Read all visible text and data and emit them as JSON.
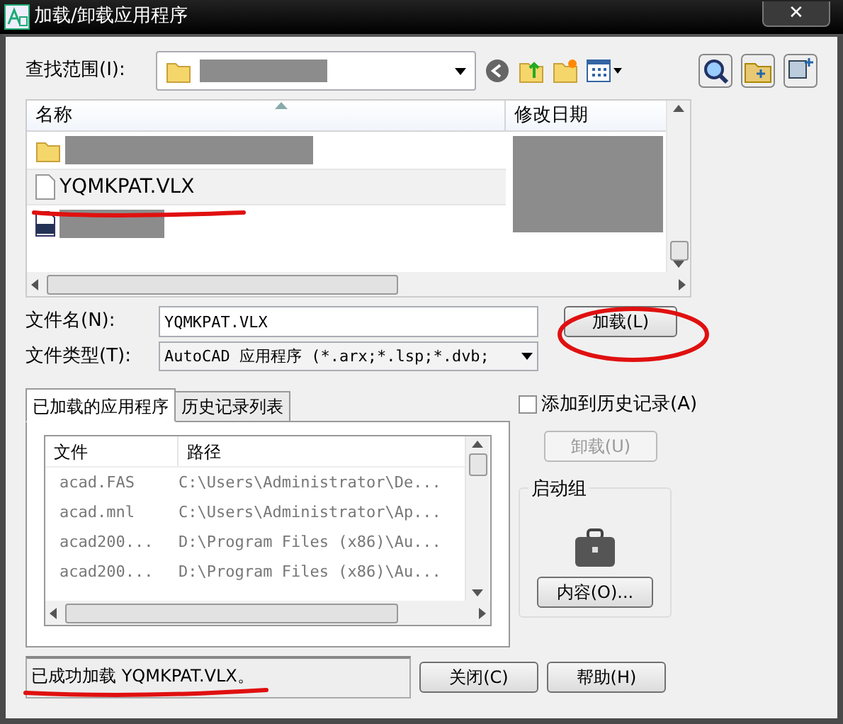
{
  "window": {
    "title": "加载/卸载应用程序",
    "close": "✕"
  },
  "look_in": {
    "label": "查找范围(I):"
  },
  "file_list": {
    "columns": [
      {
        "label": "名称",
        "sorted": true
      },
      {
        "label": "修改日期",
        "sorted": false
      }
    ],
    "rows": [
      {
        "kind": "folder",
        "selected": false
      },
      {
        "kind": "file",
        "name": "YQMKPAT.VLX",
        "selected": true
      },
      {
        "kind": "lisp",
        "selected": false
      }
    ]
  },
  "file_name": {
    "label": "文件名(N):",
    "value": "YQMKPAT.VLX"
  },
  "load_button": "加载(L)",
  "file_type": {
    "label": "文件类型(T):",
    "value": "AutoCAD 应用程序 (*.arx;*.lsp;*.dvb;"
  },
  "tabs": [
    {
      "label": "已加载的应用程序",
      "selected": true
    },
    {
      "label": "历史记录列表",
      "selected": false
    }
  ],
  "loaded_list": {
    "columns": [
      "文件",
      "路径"
    ],
    "rows": [
      [
        "acad.FAS",
        "C:\\Users\\Administrator\\De..."
      ],
      [
        "acad.mnl",
        "C:\\Users\\Administrator\\Ap..."
      ],
      [
        "acad200...",
        "D:\\Program Files (x86)\\Au..."
      ],
      [
        "acad200...",
        "D:\\Program Files (x86)\\Au..."
      ]
    ]
  },
  "add_to_history": {
    "label": "添加到历史记录(A)",
    "checked": false
  },
  "unload_button": {
    "label": "卸载(U)",
    "disabled": true
  },
  "startup_suite": {
    "title": "启动组",
    "button": "内容(O)..."
  },
  "status": "已成功加载 YQMKPAT.VLX。",
  "buttons": [
    {
      "label": "关闭(C)"
    },
    {
      "label": "帮助(H)"
    }
  ]
}
